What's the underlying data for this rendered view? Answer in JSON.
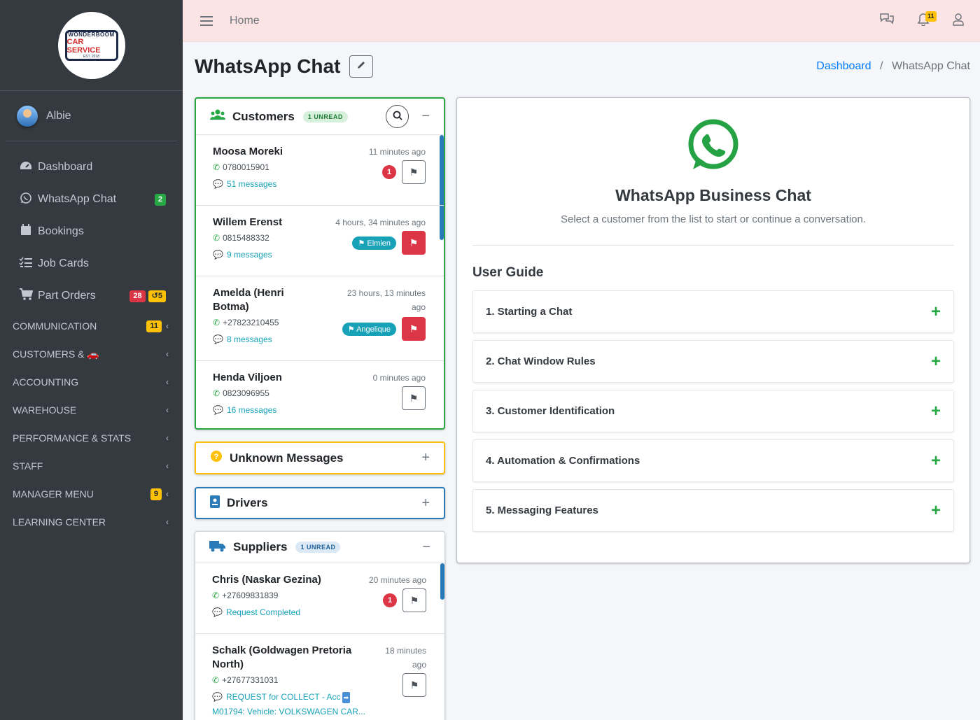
{
  "brand": {
    "logo_line1": "WONDERBOOM",
    "logo_line2": "CAR SERVICE",
    "logo_line3": "EST. 2018"
  },
  "user": {
    "name": "Albie"
  },
  "sidebar": {
    "items": [
      {
        "label": "Dashboard",
        "icon": "tachometer-icon"
      },
      {
        "label": "WhatsApp Chat",
        "icon": "whatsapp-icon",
        "badge": "2"
      },
      {
        "label": "Bookings",
        "icon": "calendar-icon"
      },
      {
        "label": "Job Cards",
        "icon": "tasks-icon"
      },
      {
        "label": "Part Orders",
        "icon": "cart-icon",
        "badge_red": "28",
        "badge_yellow": "5"
      }
    ],
    "headers": [
      {
        "label": "COMMUNICATION",
        "badge": "11"
      },
      {
        "label": "CUSTOMERS &"
      },
      {
        "label": "ACCOUNTING"
      },
      {
        "label": "WAREHOUSE"
      },
      {
        "label": "PERFORMANCE & STATS"
      },
      {
        "label": "STAFF"
      },
      {
        "label": "MANAGER MENU",
        "badge": "9"
      },
      {
        "label": "LEARNING CENTER"
      }
    ]
  },
  "topbar": {
    "home": "Home",
    "notification_count": "11"
  },
  "header": {
    "title": "WhatsApp Chat",
    "breadcrumb_link": "Dashboard",
    "breadcrumb_current": "WhatsApp Chat"
  },
  "customers": {
    "title": "Customers",
    "unread": "1 UNREAD",
    "entries": [
      {
        "name": "Moosa Moreki",
        "time": "11 minutes ago",
        "phone": "0780015901",
        "messages": "51 messages",
        "count": "1"
      },
      {
        "name": "Willem Erenst",
        "time": "4 hours, 34 minutes ago",
        "phone": "0815488332",
        "messages": "9 messages",
        "assignee": "Elmien"
      },
      {
        "name": "Amelda (Henri",
        "name2": "Botma)",
        "time": "23 hours, 13 minutes",
        "time2": "ago",
        "phone": "+27823210455",
        "messages": "8 messages",
        "assignee": "Angelique"
      },
      {
        "name": "Henda Viljoen",
        "time": "0 minutes ago",
        "phone": "0823096955",
        "messages": "16 messages"
      }
    ]
  },
  "unknown": {
    "title": "Unknown Messages"
  },
  "drivers": {
    "title": "Drivers"
  },
  "suppliers": {
    "title": "Suppliers",
    "unread": "1 UNREAD",
    "entries": [
      {
        "name": "Chris (Naskar Gezina)",
        "time": "20 minutes ago",
        "phone": "+27609831839",
        "messages": "Request Completed",
        "count": "1"
      },
      {
        "name": "Schalk (Goldwagen Pretoria",
        "name2": "North)",
        "time": "18 minutes",
        "time2": "ago",
        "phone": "+27677331031",
        "messages": "REQUEST for COLLECT - Acc",
        "messages2": "M01794: Vehicle: VOLKSWAGEN CAR..."
      }
    ]
  },
  "main": {
    "title": "WhatsApp Business Chat",
    "subtitle": "Select a customer from the list to start or continue a conversation.",
    "guide_title": "User Guide",
    "guide_items": [
      "1. Starting a Chat",
      "2. Chat Window Rules",
      "3. Customer Identification",
      "4. Automation & Confirmations",
      "5. Messaging Features"
    ]
  },
  "colors": {
    "whatsapp_green": "#25a244",
    "accent_blue": "#007bff",
    "sidebar_bg": "#343a40",
    "topbar_bg": "#fce4e4"
  }
}
